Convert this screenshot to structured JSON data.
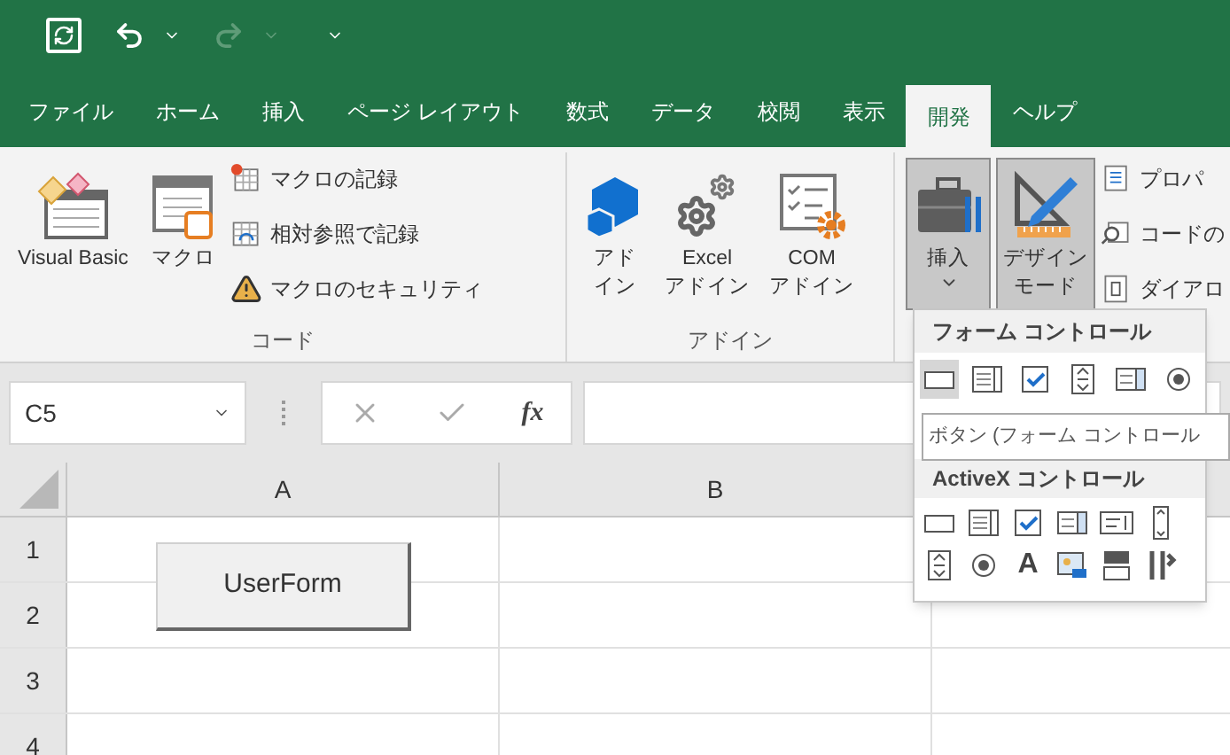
{
  "quick_access": {
    "undo": {
      "disabled": false
    },
    "redo": {
      "disabled": true
    }
  },
  "tabs": [
    {
      "label": "ファイル",
      "selected": false
    },
    {
      "label": "ホーム",
      "selected": false
    },
    {
      "label": "挿入",
      "selected": false
    },
    {
      "label": "ページ レイアウト",
      "selected": false
    },
    {
      "label": "数式",
      "selected": false
    },
    {
      "label": "データ",
      "selected": false
    },
    {
      "label": "校閲",
      "selected": false
    },
    {
      "label": "表示",
      "selected": false
    },
    {
      "label": "開発",
      "selected": true
    },
    {
      "label": "ヘルプ",
      "selected": false
    }
  ],
  "ribbon": {
    "groups": [
      {
        "label": "コード",
        "items": [
          {
            "kind": "large",
            "label": "Visual Basic",
            "pressed": false,
            "menu": false
          },
          {
            "kind": "large",
            "label": "マクロ",
            "pressed": false,
            "menu": false
          },
          {
            "kind": "small",
            "label": "マクロの記録"
          },
          {
            "kind": "small",
            "label": "相対参照で記録"
          },
          {
            "kind": "small",
            "label": "マクロのセキュリティ"
          }
        ]
      },
      {
        "label": "アドイン",
        "items": [
          {
            "kind": "large",
            "label_lines": [
              "アド",
              "イン"
            ],
            "pressed": false,
            "menu": false
          },
          {
            "kind": "large",
            "label_lines": [
              "Excel",
              "アドイン"
            ],
            "pressed": false,
            "menu": false
          },
          {
            "kind": "large",
            "label_lines": [
              "COM",
              "アドイン"
            ],
            "pressed": false,
            "menu": false
          }
        ]
      },
      {
        "items": [
          {
            "kind": "large",
            "label": "挿入",
            "pressed": true,
            "menu": true
          },
          {
            "kind": "large",
            "label_lines": [
              "デザイン",
              "モード"
            ],
            "pressed": true,
            "menu": false
          },
          {
            "kind": "small",
            "label": "プロパ"
          },
          {
            "kind": "small",
            "label": "コードの"
          },
          {
            "kind": "small",
            "label": "ダイアロ"
          }
        ]
      }
    ]
  },
  "formula_bar": {
    "name_box": "C5",
    "function_button": "fx"
  },
  "sheet": {
    "columns": [
      "A",
      "B"
    ],
    "rows": [
      "1",
      "2",
      "3",
      "4"
    ],
    "button": "UserForm"
  },
  "insert_menu": {
    "form_title": "フォーム コントロール",
    "form_controls": [
      {
        "selected": true
      },
      {
        "selected": false
      },
      {
        "selected": false
      },
      {
        "selected": false
      },
      {
        "selected": false
      },
      {
        "selected": false
      }
    ],
    "activex_title": "ActiveX コントロール",
    "label_glyph": "A",
    "tooltip": "ボタン (フォーム コントロール"
  }
}
